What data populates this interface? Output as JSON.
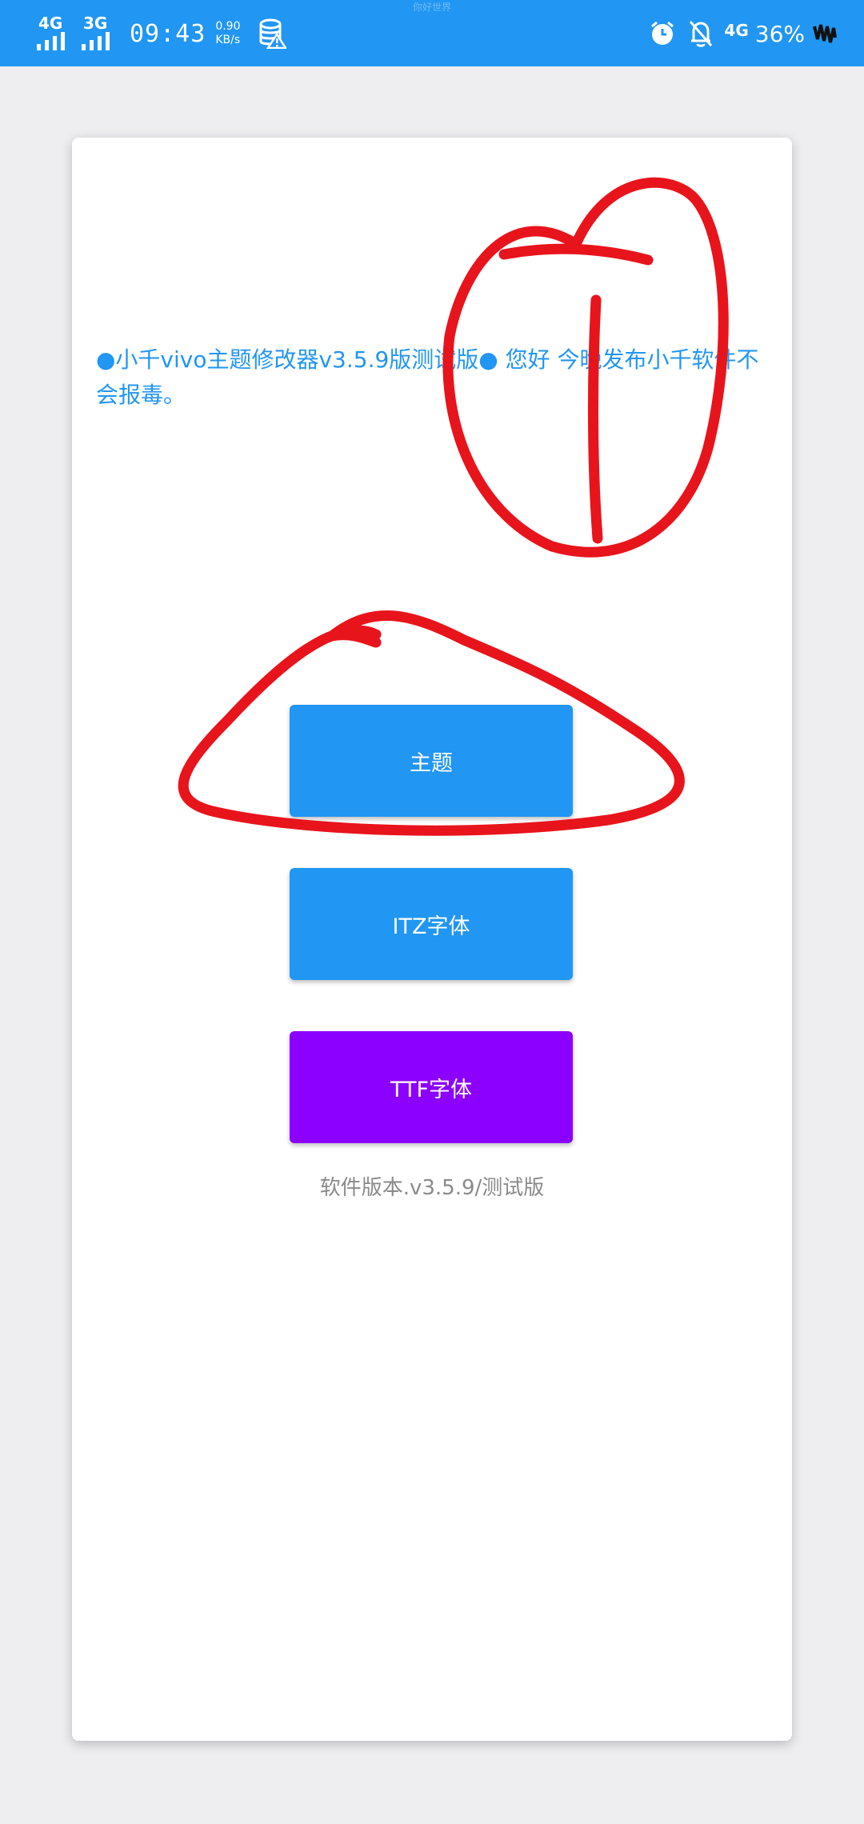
{
  "status_bar": {
    "top_notice": "你好世界",
    "network1": "4G",
    "network2": "3G",
    "time": "09:43",
    "speed_value": "0.90",
    "speed_unit": "KB/s",
    "network_right": "4G",
    "battery": "36%",
    "icons": [
      "signal-icon",
      "database-warning-icon",
      "alarm-icon",
      "bell-off-icon",
      "battery-icon"
    ]
  },
  "card": {
    "notice": "●小千vivo主题修改器v3.5.9版测试版● 您好 今晚发布小千软件不会报毒。",
    "buttons": {
      "theme": "主题",
      "itz_font": "ITZ字体",
      "ttf_font": "TTF字体"
    },
    "version": "软件版本.v3.5.9/测试版"
  },
  "colors": {
    "status_bar": "#2196f3",
    "accent_blue": "#2196f3",
    "accent_purple": "#8b00ff",
    "annotation_red": "#e8141c",
    "background": "#eeeef1"
  }
}
